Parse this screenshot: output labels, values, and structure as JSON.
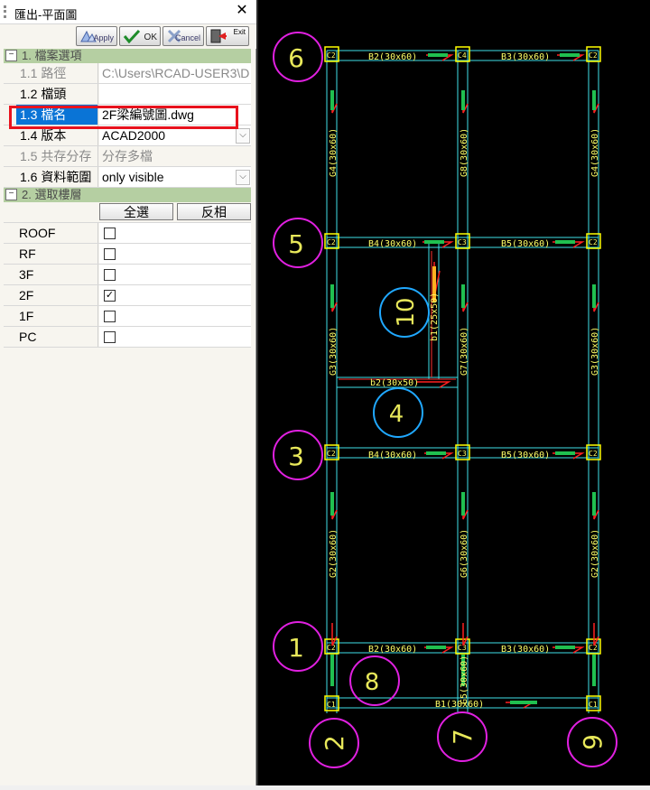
{
  "window": {
    "title": "匯出-平面圖",
    "close_glyph": "✕"
  },
  "toolbar": {
    "apply_label": "Apply",
    "ok_label": "OK",
    "cancel_label": "Cancel",
    "exit_label": "Exit"
  },
  "section1": {
    "label": "1. 檔案選項",
    "toggle": "−",
    "rows": [
      {
        "name": "1.1 路徑",
        "value": "C:\\Users\\RCAD-USER3\\D"
      },
      {
        "name": "1.2 檔頭",
        "value": ""
      },
      {
        "name": "1.3 檔名",
        "value": "2F梁編號圖.dwg"
      },
      {
        "name": "1.4 版本",
        "value": "ACAD2000"
      },
      {
        "name": "1.5 共存分存",
        "value": "分存多檔"
      },
      {
        "name": "1.6 資料範圍",
        "value": "only visible"
      }
    ]
  },
  "section2": {
    "label": "2. 選取樓層",
    "toggle": "−",
    "select_all_label": "全選",
    "invert_label": "反相",
    "floors": [
      {
        "name": "ROOF",
        "checked": false,
        "mark": ""
      },
      {
        "name": "RF",
        "checked": false,
        "mark": ""
      },
      {
        "name": "3F",
        "checked": false,
        "mark": ""
      },
      {
        "name": "2F",
        "checked": true,
        "mark": "✓"
      },
      {
        "name": "1F",
        "checked": false,
        "mark": ""
      },
      {
        "name": "PC",
        "checked": false,
        "mark": ""
      }
    ]
  },
  "colors": {
    "category_bg": "#b5cfa2",
    "selected_bg": "#0a74d6",
    "highlight_box": "#e8121d",
    "cad_background": "#000000",
    "grid_line": "#40e0e8",
    "column_box": "#ffff00",
    "label_text": "#ffff66",
    "axis_bubble": "#e020e0",
    "callout_bubble": "#20a8ff",
    "rebar_red": "#ff2020",
    "rebar_green": "#20c050"
  },
  "cad": {
    "axis_bubbles": [
      "6",
      "5",
      "3",
      "1",
      "2",
      "7",
      "9"
    ],
    "callout_bubbles": [
      "10",
      "4",
      "8"
    ],
    "beams": [
      "B2(30x60)",
      "B3(30x60)",
      "B4(30x60)",
      "B5(30x60)",
      "B4(30x60)",
      "B5(30x60)",
      "B2(30x60)",
      "B3(30x60)",
      "B1(30x60)",
      "b2(30x50)",
      "b1(25x50)"
    ],
    "girders": [
      "G4(30x60)",
      "G8(30x60)",
      "G4(30x60)",
      "G3(30x60)",
      "G7(30x60)",
      "G3(30x60)",
      "G2(30x60)",
      "G6(30x60)",
      "G2(30x60)",
      "G5(30x60)"
    ],
    "columns": [
      "C2",
      "C4",
      "C2",
      "C2",
      "C3",
      "C2",
      "C2",
      "C3",
      "C2",
      "C2",
      "C3",
      "C2",
      "C1",
      "C1"
    ]
  }
}
